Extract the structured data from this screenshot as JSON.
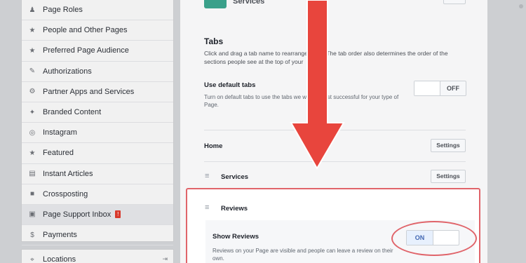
{
  "sidebar": {
    "items": [
      {
        "icon": "person-icon",
        "glyph": "♟",
        "label": "Page Roles"
      },
      {
        "icon": "people-star-icon",
        "glyph": "★",
        "label": "People and Other Pages"
      },
      {
        "icon": "people-star-icon",
        "glyph": "★",
        "label": "Preferred Page Audience"
      },
      {
        "icon": "wrench-icon",
        "glyph": "✎",
        "label": "Authorizations"
      },
      {
        "icon": "gear-icon",
        "glyph": "⚙",
        "label": "Partner Apps and Services"
      },
      {
        "icon": "handshake-icon",
        "glyph": "✦",
        "label": "Branded Content"
      },
      {
        "icon": "instagram-icon",
        "glyph": "◎",
        "label": "Instagram"
      },
      {
        "icon": "star-icon",
        "glyph": "★",
        "label": "Featured"
      },
      {
        "icon": "article-icon",
        "glyph": "▤",
        "label": "Instant Articles"
      },
      {
        "icon": "video-icon",
        "glyph": "■",
        "label": "Crossposting"
      },
      {
        "icon": "inbox-icon",
        "glyph": "▣",
        "label": "Page Support Inbox",
        "badge": "!"
      },
      {
        "icon": "dollar-icon",
        "glyph": "$",
        "label": "Payments"
      }
    ],
    "locations": {
      "icon": "location-pin-icon",
      "glyph": "⌖",
      "label": "Locations",
      "right_icon": "export-icon",
      "right_glyph": "⇥"
    }
  },
  "main": {
    "services_title": "Services",
    "tabs_title": "Tabs",
    "tabs_desc": "Click and drag a tab name to rearrange order. The tab order also determines the order of the sections people see at the top of your",
    "use_default_tabs": {
      "title": "Use default tabs",
      "desc": "Turn on default tabs to use the tabs we will be most successful for your type of Page.",
      "toggle": "OFF"
    },
    "rows": [
      {
        "label": "Home",
        "button": "Settings"
      },
      {
        "label": "Services",
        "button": "Settings"
      }
    ],
    "reviews": {
      "label": "Reviews",
      "show_title": "Show Reviews",
      "desc": "Reviews on your Page are visible and people can leave a review on their own.",
      "toggle": "ON"
    }
  },
  "colors": {
    "highlight": "#e0646a",
    "arrow": "#e8453d",
    "accent": "#4267b2"
  }
}
